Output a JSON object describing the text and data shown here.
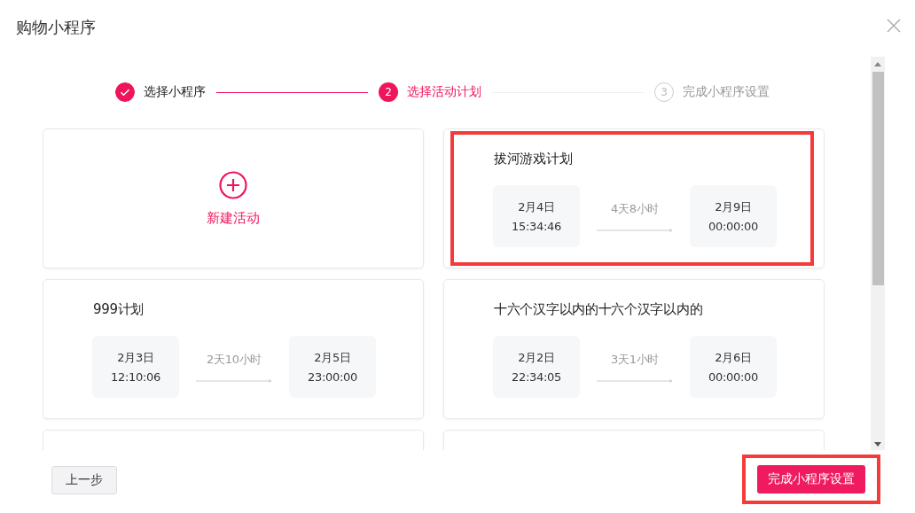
{
  "dialog": {
    "title": "购物小程序"
  },
  "steps": [
    {
      "label": "选择小程序",
      "completed": true,
      "selected": false
    },
    {
      "number": "2",
      "label": "选择活动计划",
      "completed": false,
      "selected": true
    },
    {
      "number": "3",
      "label": "完成小程序设置",
      "completed": false,
      "selected": false
    }
  ],
  "card_rows": [
    {
      "cards": [
        {
          "kind": "new",
          "label": "新建活动",
          "highlighted": false
        },
        {
          "kind": "plan",
          "name": "拔河游戏计划",
          "start_date": "2月4日",
          "start_time": "15:34:46",
          "duration": "4天8小时",
          "end_date": "2月9日",
          "end_time": "00:00:00",
          "highlighted": true
        }
      ]
    },
    {
      "cards": [
        {
          "kind": "plan",
          "name": "999计划",
          "start_date": "2月3日",
          "start_time": "12:10:06",
          "duration": "2天10小时",
          "end_date": "2月5日",
          "end_time": "23:00:00",
          "highlighted": false
        },
        {
          "kind": "plan",
          "name": "十六个汉字以内的十六个汉字以内的",
          "start_date": "2月2日",
          "start_time": "22:34:05",
          "duration": "3天1小时",
          "end_date": "2月6日",
          "end_time": "00:00:00",
          "highlighted": false
        }
      ]
    },
    {
      "cards": [
        {
          "kind": "cut"
        },
        {
          "kind": "cut"
        }
      ]
    }
  ],
  "footer": {
    "back_button": "上一步",
    "finish_button": {
      "label": "完成小程序设置",
      "highlighted": true
    }
  }
}
